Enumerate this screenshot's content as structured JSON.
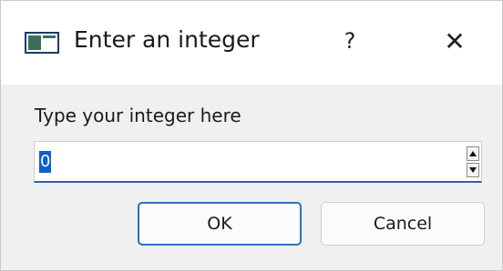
{
  "window": {
    "title": "Enter an integer",
    "help_label": "?",
    "close_label": "✕"
  },
  "dialog": {
    "prompt": "Type your integer here",
    "value": "0",
    "ok_label": "OK",
    "cancel_label": "Cancel"
  },
  "icons": {
    "app": "app-window-icon",
    "help": "help-icon",
    "close": "close-icon",
    "spin_up": "spin-up-icon",
    "spin_down": "spin-down-icon"
  },
  "colors": {
    "selection": "#0b5fd1",
    "focus_accent": "#2f6fc2"
  }
}
